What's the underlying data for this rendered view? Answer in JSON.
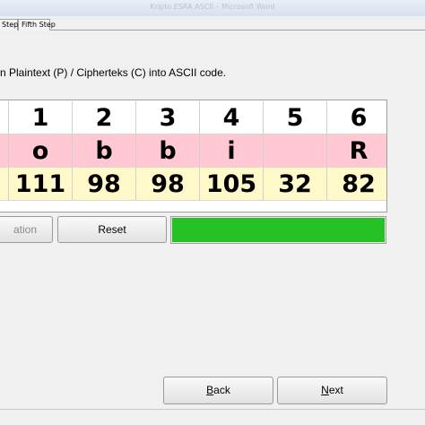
{
  "window": {
    "title": "Kripto ESRA ASCII – Microsoft Word"
  },
  "tabs": [
    {
      "label": "Step"
    },
    {
      "label": "Fifth Step"
    }
  ],
  "instruction": "n Plaintext (P) / Cipherteks (C) into ASCII code.",
  "table": {
    "index_row": [
      "",
      "1",
      "2",
      "3",
      "4",
      "5",
      "6"
    ],
    "char_row": [
      "",
      "o",
      "b",
      "b",
      "i",
      "",
      "R"
    ],
    "code_row": [
      "",
      "111",
      "98",
      "98",
      "105",
      "32",
      "82"
    ],
    "colors": {
      "index": "#ffffff",
      "chars": "#ffc8d2",
      "codes": "#fff8c8"
    }
  },
  "scrollbar": {
    "arrow": "right-arrow-icon",
    "grip": "|||"
  },
  "buttons": {
    "translate": "ation",
    "reset": "Reset",
    "back_first": "B",
    "back_rest": "ack",
    "next_first": "N",
    "next_rest": "ext"
  },
  "progress": {
    "value": 1.0,
    "color": "#25c125"
  }
}
